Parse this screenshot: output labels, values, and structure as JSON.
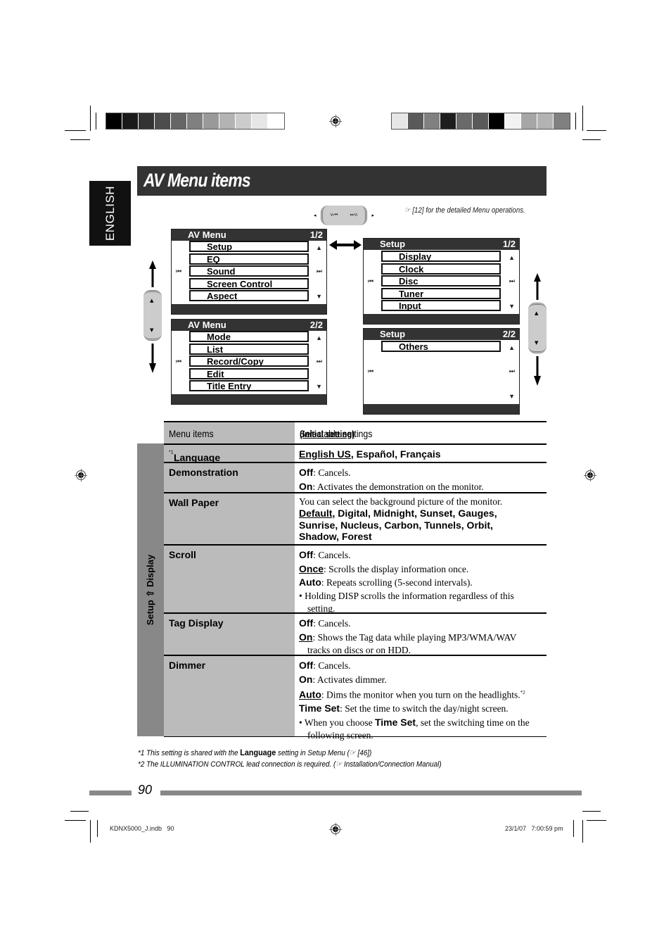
{
  "print_marks": {
    "slug_left": "KDNX5000_J.indb   90",
    "slug_right": "23/1/07   7:00:59 pm",
    "color_bar_left": [
      "#000000",
      "#1a1a1a",
      "#333333",
      "#4d4d4d",
      "#666666",
      "#808080",
      "#999999",
      "#b3b3b3",
      "#cccccc",
      "#e6e6e6",
      "#ffffff"
    ],
    "color_bar_right": [
      "#e6e6e6",
      "#5a5a5a",
      "#808080",
      "#1e1e1e",
      "#6a6a6a",
      "#5a5a5a",
      "#000000",
      "#f2f2f2",
      "#a6a6a6",
      "#b3b3b3",
      "#808080"
    ]
  },
  "side_tab": {
    "label": "ENGLISH"
  },
  "header": {
    "title": "AV Menu items",
    "reference_note": "☞ [12] for the detailed Menu operations."
  },
  "controller": {
    "horizontal": {
      "left_label": "∨⏮",
      "right_label": "⏭∧"
    },
    "vertical": {
      "up_label": "▲",
      "down_label": "▼"
    }
  },
  "screens": {
    "av_menu_1": {
      "title": "AV Menu",
      "page": "1/2",
      "items": [
        "Setup",
        "EQ",
        "Sound",
        "Screen Control",
        "Aspect"
      ]
    },
    "av_menu_2": {
      "title": "AV Menu",
      "page": "2/2",
      "items": [
        "Mode",
        "List",
        "Record/Copy",
        "Edit",
        "Title Entry"
      ]
    },
    "setup_1": {
      "title": "Setup",
      "page": "1/2",
      "items": [
        "Display",
        "Clock",
        "Disc",
        "Tuner",
        "Input"
      ]
    },
    "setup_2": {
      "title": "Setup",
      "page": "2/2",
      "items": [
        "Others"
      ]
    },
    "icons": {
      "prev": "⏮",
      "next": "⏭",
      "up": "▲",
      "down": "▼"
    }
  },
  "table": {
    "col_menu_items": "Menu items",
    "col_selectable": "Selectable settings",
    "initial_setting": "(Initial setting)",
    "group_label": "Setup ⇧ Display",
    "rows": [
      {
        "name": "Language",
        "sup": "*1",
        "options": [
          {
            "text": "English US",
            "initial": true
          },
          {
            "text": ", Español, Français",
            "initial": false
          }
        ]
      },
      {
        "name": "Demonstration",
        "lines": [
          {
            "key": "Off",
            "initial": false,
            "desc": ": Cancels."
          },
          {
            "key": "On",
            "initial": false,
            "desc": ": Activates the demonstration on the monitor."
          }
        ]
      },
      {
        "name": "Wall Paper",
        "intro": "You can select the background picture of the monitor.",
        "options_initial": "Default",
        "options_rest_1": ", Digital, Midnight, Sunset, Gauges,",
        "options_rest_2": "Sunrise, Nucleus, Carbon, Tunnels, Orbit,",
        "options_rest_3": "Shadow, Forest"
      },
      {
        "name": "Scroll",
        "lines": [
          {
            "key": "Off",
            "initial": false,
            "desc": ": Cancels."
          },
          {
            "key": "Once",
            "initial": true,
            "desc": ": Scrolls the display information once."
          },
          {
            "key": "Auto",
            "initial": false,
            "desc": ": Repeats scrolling (5-second intervals)."
          }
        ],
        "bullet": "Holding DISP scrolls the information regardless of this setting."
      },
      {
        "name": "Tag Display",
        "lines": [
          {
            "key": "Off",
            "initial": false,
            "desc": ": Cancels."
          },
          {
            "key": "On",
            "initial": true,
            "desc": ": Shows the Tag data while playing MP3/WMA/WAV"
          }
        ],
        "continuation": "tracks on discs or on HDD."
      },
      {
        "name": "Dimmer",
        "lines": [
          {
            "key": "Off",
            "initial": false,
            "desc": ": Cancels."
          },
          {
            "key": "On",
            "initial": false,
            "desc": ": Activates dimmer."
          },
          {
            "key": "Auto",
            "initial": true,
            "desc": ": Dims the monitor when you turn on the headlights.",
            "sup": "*2"
          },
          {
            "key": "Time Set",
            "initial": false,
            "desc": ": Set the time to switch the day/night screen."
          }
        ],
        "bullet_pre": "When you choose ",
        "bullet_key": "Time Set",
        "bullet_post": ", set the switching time on the following screen."
      }
    ]
  },
  "footnotes": {
    "fn1_pre": "*1 This setting is shared with the ",
    "fn1_key": "Language",
    "fn1_post": " setting in Setup Menu (☞ [46])",
    "fn2": "*2 The ILLUMINATION CONTROL lead connection is required. (☞ Installation/Connection Manual)"
  },
  "page_number": "90"
}
